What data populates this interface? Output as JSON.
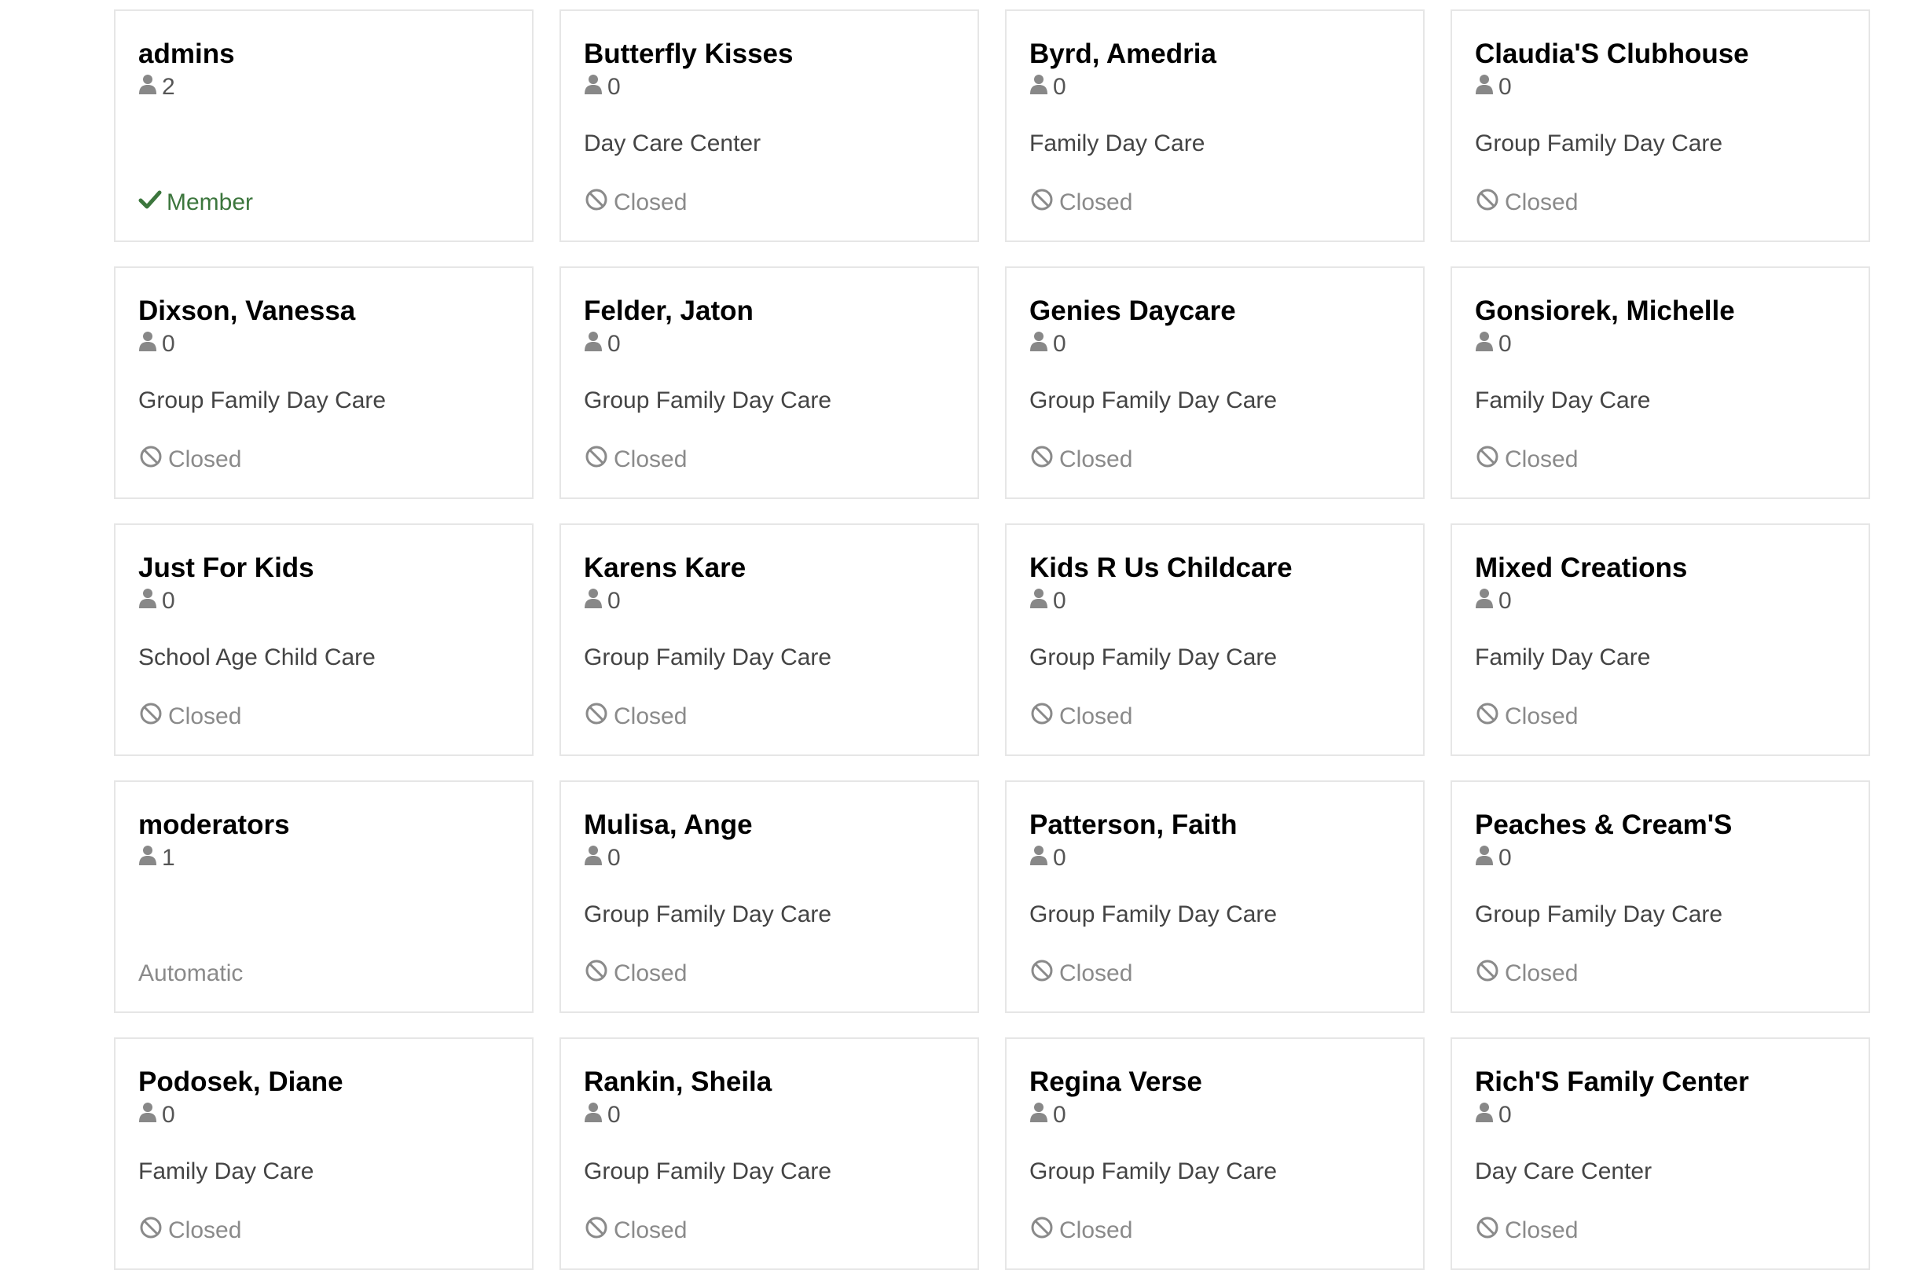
{
  "groups": [
    {
      "name": "admins",
      "member_count": "2",
      "category": "",
      "status": "Member",
      "status_type": "member"
    },
    {
      "name": "Butterfly Kisses",
      "member_count": "0",
      "category": "Day Care Center",
      "status": "Closed",
      "status_type": "closed"
    },
    {
      "name": "Byrd, Amedria",
      "member_count": "0",
      "category": "Family Day Care",
      "status": "Closed",
      "status_type": "closed"
    },
    {
      "name": "Claudia'S Clubhouse",
      "member_count": "0",
      "category": "Group Family Day Care",
      "status": "Closed",
      "status_type": "closed"
    },
    {
      "name": "Dixson, Vanessa",
      "member_count": "0",
      "category": "Group Family Day Care",
      "status": "Closed",
      "status_type": "closed"
    },
    {
      "name": "Felder, Jaton",
      "member_count": "0",
      "category": "Group Family Day Care",
      "status": "Closed",
      "status_type": "closed"
    },
    {
      "name": "Genies Daycare",
      "member_count": "0",
      "category": "Group Family Day Care",
      "status": "Closed",
      "status_type": "closed"
    },
    {
      "name": "Gonsiorek, Michelle",
      "member_count": "0",
      "category": "Family Day Care",
      "status": "Closed",
      "status_type": "closed"
    },
    {
      "name": "Just For Kids",
      "member_count": "0",
      "category": "School Age Child Care",
      "status": "Closed",
      "status_type": "closed"
    },
    {
      "name": "Karens Kare",
      "member_count": "0",
      "category": "Group Family Day Care",
      "status": "Closed",
      "status_type": "closed"
    },
    {
      "name": "Kids R Us Childcare",
      "member_count": "0",
      "category": "Group Family Day Care",
      "status": "Closed",
      "status_type": "closed"
    },
    {
      "name": "Mixed Creations",
      "member_count": "0",
      "category": "Family Day Care",
      "status": "Closed",
      "status_type": "closed"
    },
    {
      "name": "moderators",
      "member_count": "1",
      "category": "",
      "status": "Automatic",
      "status_type": "automatic"
    },
    {
      "name": "Mulisa, Ange",
      "member_count": "0",
      "category": "Group Family Day Care",
      "status": "Closed",
      "status_type": "closed"
    },
    {
      "name": "Patterson, Faith",
      "member_count": "0",
      "category": "Group Family Day Care",
      "status": "Closed",
      "status_type": "closed"
    },
    {
      "name": "Peaches & Cream'S",
      "member_count": "0",
      "category": "Group Family Day Care",
      "status": "Closed",
      "status_type": "closed"
    },
    {
      "name": "Podosek, Diane",
      "member_count": "0",
      "category": "Family Day Care",
      "status": "Closed",
      "status_type": "closed"
    },
    {
      "name": "Rankin, Sheila",
      "member_count": "0",
      "category": "Group Family Day Care",
      "status": "Closed",
      "status_type": "closed"
    },
    {
      "name": "Regina Verse",
      "member_count": "0",
      "category": "Group Family Day Care",
      "status": "Closed",
      "status_type": "closed"
    },
    {
      "name": "Rich'S Family Center",
      "member_count": "0",
      "category": "Day Care Center",
      "status": "Closed",
      "status_type": "closed"
    }
  ],
  "icons": {
    "member_count_icon": "user-icon",
    "closed_icon": "ban-icon",
    "member_icon": "check-icon"
  },
  "colors": {
    "member_status": "#3c763d",
    "closed_status": "#8a8a8a",
    "card_border": "#e6e6e6"
  }
}
